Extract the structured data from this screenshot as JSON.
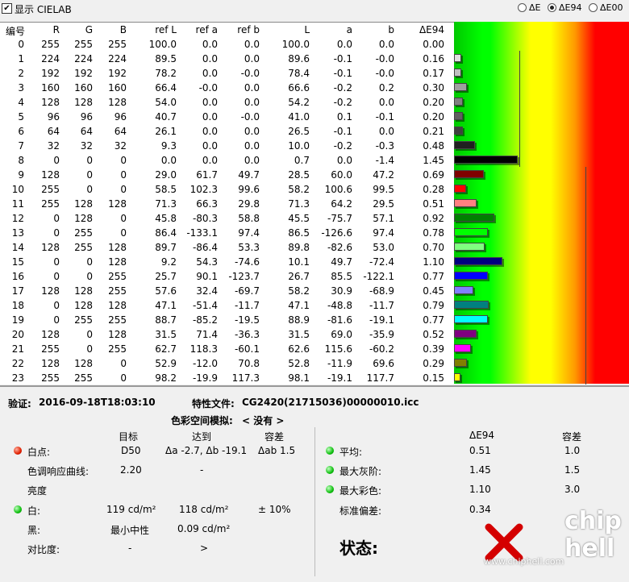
{
  "toolbar": {
    "show_cielab_label": "显示 CIELAB",
    "show_cielab_checked": true,
    "radio_options": [
      "ΔE",
      "ΔE94",
      "ΔE00"
    ],
    "radio_selected": "ΔE94"
  },
  "table": {
    "headers": [
      "编号",
      "R",
      "G",
      "B",
      "ref L",
      "ref a",
      "ref b",
      "L",
      "a",
      "b",
      "ΔE94"
    ],
    "rows": [
      [
        "0",
        "255",
        "255",
        "255",
        "100.0",
        "0.0",
        "0.0",
        "100.0",
        "0.0",
        "0.0",
        "0.00"
      ],
      [
        "1",
        "224",
        "224",
        "224",
        "89.5",
        "0.0",
        "0.0",
        "89.6",
        "-0.1",
        "-0.0",
        "0.16"
      ],
      [
        "2",
        "192",
        "192",
        "192",
        "78.2",
        "0.0",
        "-0.0",
        "78.4",
        "-0.1",
        "-0.0",
        "0.17"
      ],
      [
        "3",
        "160",
        "160",
        "160",
        "66.4",
        "-0.0",
        "0.0",
        "66.6",
        "-0.2",
        "0.2",
        "0.30"
      ],
      [
        "4",
        "128",
        "128",
        "128",
        "54.0",
        "0.0",
        "0.0",
        "54.2",
        "-0.2",
        "0.0",
        "0.20"
      ],
      [
        "5",
        "96",
        "96",
        "96",
        "40.7",
        "0.0",
        "-0.0",
        "41.0",
        "0.1",
        "-0.1",
        "0.20"
      ],
      [
        "6",
        "64",
        "64",
        "64",
        "26.1",
        "0.0",
        "0.0",
        "26.5",
        "-0.1",
        "0.0",
        "0.21"
      ],
      [
        "7",
        "32",
        "32",
        "32",
        "9.3",
        "0.0",
        "0.0",
        "10.0",
        "-0.2",
        "-0.3",
        "0.48"
      ],
      [
        "8",
        "0",
        "0",
        "0",
        "0.0",
        "0.0",
        "0.0",
        "0.7",
        "0.0",
        "-1.4",
        "1.45"
      ],
      [
        "9",
        "128",
        "0",
        "0",
        "29.0",
        "61.7",
        "49.7",
        "28.5",
        "60.0",
        "47.2",
        "0.69"
      ],
      [
        "10",
        "255",
        "0",
        "0",
        "58.5",
        "102.3",
        "99.6",
        "58.2",
        "100.6",
        "99.5",
        "0.28"
      ],
      [
        "11",
        "255",
        "128",
        "128",
        "71.3",
        "66.3",
        "29.8",
        "71.3",
        "64.2",
        "29.5",
        "0.51"
      ],
      [
        "12",
        "0",
        "128",
        "0",
        "45.8",
        "-80.3",
        "58.8",
        "45.5",
        "-75.7",
        "57.1",
        "0.92"
      ],
      [
        "13",
        "0",
        "255",
        "0",
        "86.4",
        "-133.1",
        "97.4",
        "86.5",
        "-126.6",
        "97.4",
        "0.78"
      ],
      [
        "14",
        "128",
        "255",
        "128",
        "89.7",
        "-86.4",
        "53.3",
        "89.8",
        "-82.6",
        "53.0",
        "0.70"
      ],
      [
        "15",
        "0",
        "0",
        "128",
        "9.2",
        "54.3",
        "-74.6",
        "10.1",
        "49.7",
        "-72.4",
        "1.10"
      ],
      [
        "16",
        "0",
        "0",
        "255",
        "25.7",
        "90.1",
        "-123.7",
        "26.7",
        "85.5",
        "-122.1",
        "0.77"
      ],
      [
        "17",
        "128",
        "128",
        "255",
        "57.6",
        "32.4",
        "-69.7",
        "58.2",
        "30.9",
        "-68.9",
        "0.45"
      ],
      [
        "18",
        "0",
        "128",
        "128",
        "47.1",
        "-51.4",
        "-11.7",
        "47.1",
        "-48.8",
        "-11.7",
        "0.79"
      ],
      [
        "19",
        "0",
        "255",
        "255",
        "88.7",
        "-85.2",
        "-19.5",
        "88.9",
        "-81.6",
        "-19.1",
        "0.77"
      ],
      [
        "20",
        "128",
        "0",
        "128",
        "31.5",
        "71.4",
        "-36.3",
        "31.5",
        "69.0",
        "-35.9",
        "0.52"
      ],
      [
        "21",
        "255",
        "0",
        "255",
        "62.7",
        "118.3",
        "-60.1",
        "62.6",
        "115.6",
        "-60.2",
        "0.39"
      ],
      [
        "22",
        "128",
        "128",
        "0",
        "52.9",
        "-12.0",
        "70.8",
        "52.8",
        "-11.9",
        "69.6",
        "0.29"
      ],
      [
        "23",
        "255",
        "255",
        "0",
        "98.2",
        "-19.9",
        "117.3",
        "98.1",
        "-19.1",
        "117.7",
        "0.15"
      ]
    ]
  },
  "chart_data": {
    "type": "bar",
    "orientation": "horizontal",
    "categories": [
      "0",
      "1",
      "2",
      "3",
      "4",
      "5",
      "6",
      "7",
      "8",
      "9",
      "10",
      "11",
      "12",
      "13",
      "14",
      "15",
      "16",
      "17",
      "18",
      "19",
      "20",
      "21",
      "22",
      "23"
    ],
    "values": [
      0.0,
      0.16,
      0.17,
      0.3,
      0.2,
      0.2,
      0.21,
      0.48,
      1.45,
      0.69,
      0.28,
      0.51,
      0.92,
      0.78,
      0.7,
      1.1,
      0.77,
      0.45,
      0.79,
      0.77,
      0.52,
      0.39,
      0.29,
      0.15
    ],
    "bar_colors": [
      "#ffffff",
      "#e0e0e0",
      "#c0c0c0",
      "#a0a0a0",
      "#808080",
      "#606060",
      "#404040",
      "#202020",
      "#000000",
      "#800000",
      "#ff0000",
      "#ff8080",
      "#008000",
      "#00ff00",
      "#80ff80",
      "#000080",
      "#0000ff",
      "#8080ff",
      "#008080",
      "#00ffff",
      "#800080",
      "#ff00ff",
      "#808000",
      "#ffff00"
    ],
    "xlim": [
      0,
      4
    ],
    "threshold_lines": [
      {
        "value": 1.5,
        "from_row": 1,
        "to_row": 8
      },
      {
        "value": 3.0,
        "from_row": 9,
        "to_row": 23
      }
    ]
  },
  "summary": {
    "verify_label": "验证:",
    "verify_time": "2016-09-18T18:03:10",
    "profile_label": "特性文件:",
    "profile_name": "CG2420(21715036)00000010.icc",
    "gamut_label": "色彩空间模拟:",
    "gamut_value": "< 没有 >",
    "col_target": "目标",
    "col_achieved": "达到",
    "col_tolerance": "容差",
    "whitepoint_label": "白点:",
    "whitepoint_target": "D50",
    "whitepoint_achieved": "Δa -2.7, Δb -19.1",
    "whitepoint_tolerance": "Δab 1.5",
    "tone_label": "色调响应曲线:",
    "tone_target": "2.20",
    "tone_achieved": "-",
    "brightness_label": "亮度",
    "white_label": "白:",
    "white_target": "119 cd/m²",
    "white_achieved": "118 cd/m²",
    "white_tolerance": "± 10%",
    "black_label": "黑:",
    "black_target": "最小中性",
    "black_achieved": "0.09 cd/m²",
    "contrast_label": "对比度:",
    "contrast_target": "-",
    "contrast_achieved": ">",
    "right_col_de": "ΔE94",
    "right_col_tol": "容差",
    "avg_label": "平均:",
    "avg_value": "0.51",
    "avg_tol": "1.0",
    "maxgray_label": "最大灰阶:",
    "maxgray_value": "1.45",
    "maxgray_tol": "1.5",
    "maxcolor_label": "最大彩色:",
    "maxcolor_value": "1.10",
    "maxcolor_tol": "3.0",
    "stddev_label": "标准偏差:",
    "stddev_value": "0.34",
    "status_label": "状态:",
    "watermark": "www.chiphell.com",
    "logo_text": "chip hell"
  }
}
